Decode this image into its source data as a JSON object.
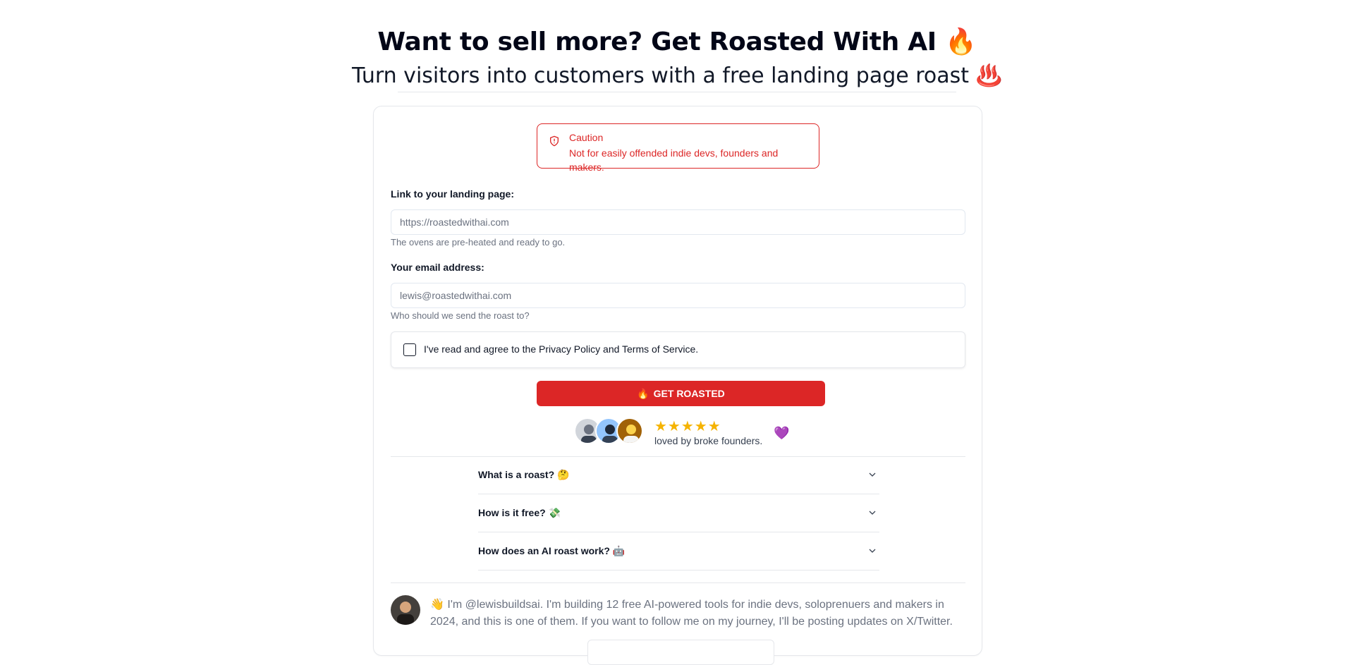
{
  "hero": {
    "title": "Want to sell more? Get Roasted With AI 🔥",
    "subtitle": "Turn visitors into customers with a free landing page roast ♨️"
  },
  "caution": {
    "title": "Caution",
    "text": "Not for easily offended indie devs, founders and makers.",
    "icon": "shield-alert-icon"
  },
  "form": {
    "url_label": "Link to your landing page:",
    "url_placeholder": "https://roastedwithai.com",
    "url_value": "",
    "url_hint": "The ovens are pre-heated and ready to go.",
    "email_label": "Your email address:",
    "email_placeholder": "lewis@roastedwithai.com",
    "email_value": "",
    "email_hint": "Who should we send the roast to?",
    "terms_text": "I've read and agree to the Privacy Policy and Terms of Service.",
    "terms_checked": false,
    "submit_icon": "🔥",
    "submit_label": "GET ROASTED"
  },
  "social_proof": {
    "stars": "★★★★★",
    "rating": 5,
    "text": "loved by broke founders.",
    "heart": "💜",
    "avatars": [
      "avatar-1",
      "avatar-2",
      "avatar-3"
    ]
  },
  "faq": [
    {
      "question": "What is a roast? 🤔"
    },
    {
      "question": "How is it free? 💸"
    },
    {
      "question": "How does an AI roast work? 🤖"
    }
  ],
  "author": {
    "text": "👋 I'm @lewisbuildsai. I'm building 12 free AI-powered tools for indie devs, soloprenuers and makers in 2024, and this is one of them. If you want to follow me on my journey, I'll be posting updates on X/Twitter."
  },
  "colors": {
    "accent": "#dc2626",
    "border": "#e5e7eb",
    "muted_text": "#6b7280",
    "star": "#f5b301"
  }
}
